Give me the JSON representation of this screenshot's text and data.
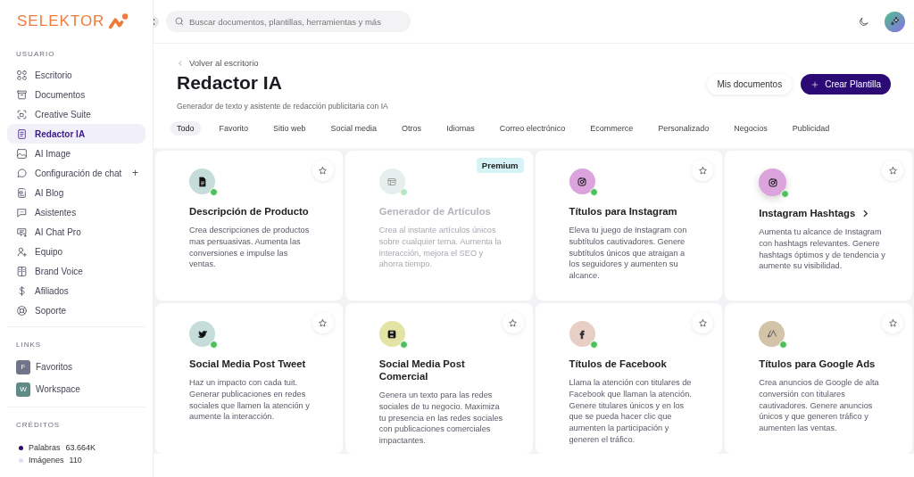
{
  "brand": {
    "name": "SELEKTOR"
  },
  "sidebar": {
    "sections": [
      {
        "title": "USUARIO",
        "items": [
          {
            "label": "Escritorio",
            "kind": "grid",
            "selected": false
          },
          {
            "label": "Documentos",
            "kind": "archive",
            "selected": false
          },
          {
            "label": "Creative Suite",
            "kind": "frame",
            "selected": false
          },
          {
            "label": "Redactor IA",
            "kind": "doc",
            "selected": true
          },
          {
            "label": "AI Image",
            "kind": "image",
            "selected": false
          },
          {
            "label": "Configuración de chat",
            "kind": "chat",
            "selected": false,
            "action": "+"
          },
          {
            "label": "AI Blog",
            "kind": "blog",
            "selected": false
          },
          {
            "label": "Asistentes",
            "kind": "chat2",
            "selected": false
          },
          {
            "label": "AI Chat Pro",
            "kind": "chat3",
            "selected": false
          },
          {
            "label": "Equipo",
            "kind": "user",
            "selected": false
          },
          {
            "label": "Brand Voice",
            "kind": "book",
            "selected": false
          },
          {
            "label": "Afiliados",
            "kind": "dollar",
            "selected": false
          },
          {
            "label": "Soporte",
            "kind": "lifebuoy",
            "selected": false
          }
        ]
      },
      {
        "title": "LINKS",
        "links": [
          {
            "letter": "F",
            "label": "Favoritos",
            "color": "#6f7488"
          },
          {
            "letter": "W",
            "label": "Workspace",
            "color": "#5f8a85"
          }
        ]
      },
      {
        "title": "CRÉDITOS",
        "credits": [
          {
            "label": "Palabras",
            "value": "63.664K",
            "color": "#2a0a6e"
          },
          {
            "label": "Imágenes",
            "value": "110",
            "color": "#e4dcf7"
          }
        ]
      }
    ]
  },
  "topbar": {
    "search_placeholder": "Buscar documentos, plantillas, herramientas y más"
  },
  "header": {
    "back_link": "Volver al escritorio",
    "title": "Redactor IA",
    "subtitle": "Generador de texto y asistente de redacción publicitaria con IA",
    "buttons": [
      {
        "label": "Mis documentos",
        "kind": "secondary"
      },
      {
        "label": "Crear Plantilla",
        "kind": "primary"
      }
    ]
  },
  "filters": [
    {
      "label": "Todo",
      "selected": true
    },
    {
      "label": "Favorito",
      "selected": false
    },
    {
      "label": "Sitio web",
      "selected": false
    },
    {
      "label": "Social media",
      "selected": false
    },
    {
      "label": "Otros",
      "selected": false
    },
    {
      "label": "Idiomas",
      "selected": false
    },
    {
      "label": "Correo electrónico",
      "selected": false
    },
    {
      "label": "Ecommerce",
      "selected": false
    },
    {
      "label": "Personalizado",
      "selected": false
    },
    {
      "label": "Negocios",
      "selected": false
    },
    {
      "label": "Publicidad",
      "selected": false
    }
  ],
  "cards": [
    {
      "title": "Descripción de Producto",
      "description": "Crea descripciones de productos mas persuasivas. Aumenta las conversiones e impulse las ventas.",
      "kind": "doc",
      "color": "#c5dcd9",
      "disabled": false,
      "hovered": false
    },
    {
      "title": "Generador de Artículos",
      "description": "Crea al instante artículos únicos sobre cualquier tema. Aumenta la interacción, mejora el SEO y ahorra tiempo.",
      "kind": "layout",
      "color": "#e6efee",
      "disabled": true,
      "hovered": false,
      "badge": "Premium"
    },
    {
      "title": "Títulos para Instagram",
      "description": "Eleva tu juego de Instagram con subtítulos cautivadores. Genere subtítulos únicos que atraigan a los seguidores y aumenten su alcance.",
      "kind": "instagram",
      "color": "#dca4dc",
      "disabled": false,
      "hovered": false
    },
    {
      "title": "Instagram Hashtags",
      "description": "Aumenta tu alcance de Instagram con hashtags relevantes. Genere hashtags óptimos y de tendencia y aumente su visibilidad.",
      "kind": "instagram",
      "color": "#dca4dc",
      "disabled": false,
      "hovered": true
    },
    {
      "title": "Social Media Post Tweet",
      "description": "Haz un impacto con cada tuit. Generar publicaciones en redes sociales que llamen la atención y aumente la interacción.",
      "kind": "twitter",
      "color": "#c5dcd9",
      "disabled": false,
      "hovered": false
    },
    {
      "title": "Social Media Post Comercial",
      "description": "Genera un texto para las redes sociales de tu negocio. Maximiza tu presencia en las redes sociales con publicaciones comerciales impactantes.",
      "kind": "save",
      "color": "#e3e3a3",
      "disabled": false,
      "hovered": false
    },
    {
      "title": "Títulos de Facebook",
      "description": "Llama la atención con titulares de Facebook que llaman la atención. Genere titulares únicos y en los que se pueda hacer clic que aumenten la participación y generen el tráfico.",
      "kind": "facebook",
      "color": "#e8cfc6",
      "disabled": false,
      "hovered": false
    },
    {
      "title": "Títulos para Google Ads",
      "description": "Crea anuncios de Google de alta conversión con titulares cautivadores. Genere anuncios únicos y que generen tráfico y aumenten las ventas.",
      "kind": "ads",
      "color": "#d3c3a8",
      "disabled": false,
      "hovered": false
    }
  ]
}
